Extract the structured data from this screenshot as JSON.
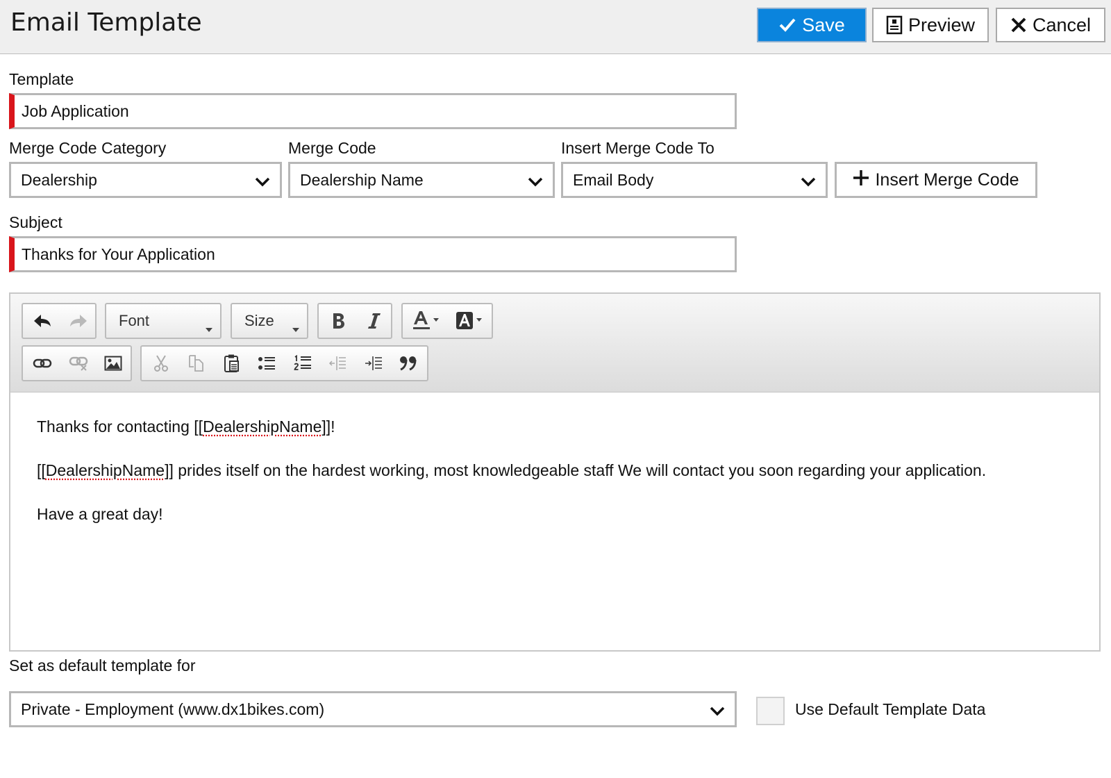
{
  "header": {
    "title": "Email Template",
    "save_label": "Save",
    "preview_label": "Preview",
    "cancel_label": "Cancel"
  },
  "template": {
    "label": "Template",
    "value": "Job Application"
  },
  "merge": {
    "category_label": "Merge Code Category",
    "category_value": "Dealership",
    "code_label": "Merge Code",
    "code_value": "Dealership Name",
    "insert_to_label": "Insert Merge Code To",
    "insert_to_value": "Email Body",
    "insert_button_label": "Insert Merge Code"
  },
  "subject": {
    "label": "Subject",
    "value": "Thanks for Your Application"
  },
  "editor": {
    "font_label": "Font",
    "size_label": "Size",
    "body": {
      "line1_prefix": "Thanks for contacting [[",
      "line1_code": "DealershipName",
      "line1_suffix": "]]!",
      "line2_prefix": "[[",
      "line2_code": "DealershipName",
      "line2_suffix": "]] prides itself on the hardest working, most knowledgeable staff We will contact you soon regarding your application.",
      "line3": "Have a great day!"
    }
  },
  "footer": {
    "default_label": "Set as default template for",
    "default_value": "Private - Employment (www.dx1bikes.com)",
    "use_default_label": "Use Default Template Data",
    "use_default_checked": false
  },
  "colors": {
    "save_button": "#0a84dd",
    "required_marker": "#d9151b"
  }
}
